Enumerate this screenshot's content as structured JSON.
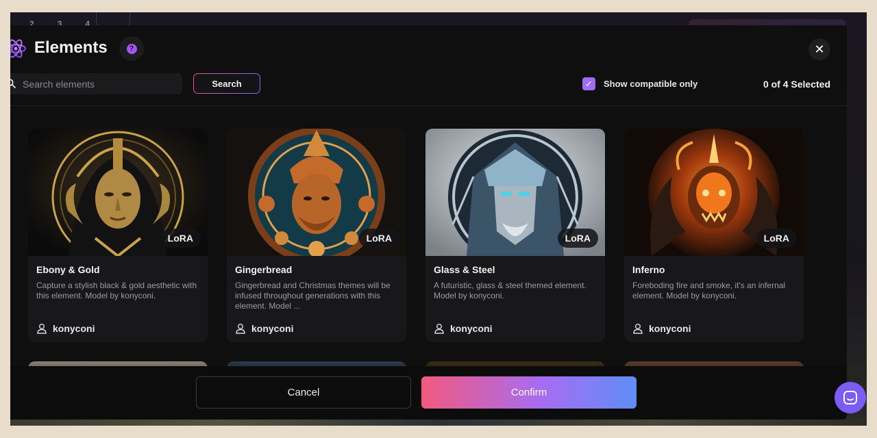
{
  "background": {
    "steps": [
      "2",
      "3",
      "4"
    ]
  },
  "modal": {
    "title": "Elements",
    "help_glyph": "?",
    "close_glyph": "✕",
    "search": {
      "placeholder": "Search elements",
      "button_label": "Search"
    },
    "compatible_toggle": {
      "label": "Show compatible only",
      "checked": true,
      "check_glyph": "✓"
    },
    "selected_count": "0 of 4 Selected",
    "cards": [
      {
        "title": "Ebony & Gold",
        "badge": "LoRA",
        "description": "Capture a stylish black & gold aesthetic with this element. Model by konyconi.",
        "author": "konyconi",
        "theme_colors": [
          "#0d0d0e",
          "#c9a24a",
          "#3a2c14"
        ]
      },
      {
        "title": "Gingerbread",
        "badge": "LoRA",
        "description": "Gingerbread and Christmas themes will be infused throughout generations with this element. Model ...",
        "author": "konyconi",
        "theme_colors": [
          "#123b47",
          "#c46a2a",
          "#e3a04c"
        ]
      },
      {
        "title": "Glass & Steel",
        "badge": "LoRA",
        "description": "A futuristic, glass & steel themed element. Model by konyconi.",
        "author": "konyconi",
        "theme_colors": [
          "#c9d2d8",
          "#4c7a9c",
          "#1d2a36"
        ]
      },
      {
        "title": "Inferno",
        "badge": "LoRA",
        "description": "Foreboding fire and smoke, it's an infernal element. Model by konyconi.",
        "author": "konyconi",
        "theme_colors": [
          "#160c08",
          "#f0771c",
          "#7a2308"
        ]
      }
    ],
    "footer": {
      "cancel_label": "Cancel",
      "confirm_label": "Confirm"
    }
  },
  "colors": {
    "accent_purple": "#a06cf3",
    "confirm_gradient_start": "#f25a7e",
    "confirm_gradient_end": "#5f8ef7",
    "modal_bg": "#0f0f10",
    "card_bg": "#18181a"
  },
  "icons": {
    "logo": "atom-icon",
    "help": "question-icon",
    "close": "close-icon",
    "search": "search-icon",
    "author": "user-icon",
    "chat": "chat-icon"
  }
}
